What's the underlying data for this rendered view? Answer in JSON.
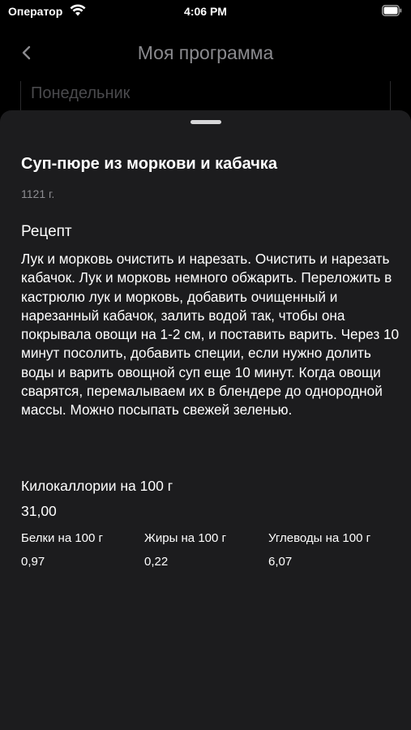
{
  "status_bar": {
    "carrier": "Оператор",
    "time": "4:06 PM"
  },
  "nav": {
    "title": "Моя программа",
    "back_icon": "chevron-left-icon"
  },
  "background": {
    "field_text": "Понедельник"
  },
  "sheet": {
    "title": "Суп-пюре из моркови и кабачка",
    "weight": "1121 г.",
    "recipe_heading": "Рецепт",
    "recipe_text": "Лук и морковь очистить и нарезать. Очистить и нарезать кабачок. Лук и морковь немного обжарить. Переложить в кастрюлю лук и морковь, добавить очищенный и нарезанный кабачок, залить водой так, чтобы она покрывала овощи на 1-2 см, и поставить варить. Через 10 минут посолить, добавить специи, если нужно долить воды и варить овощной суп еще 10 минут. Когда овощи сварятся, перемалываем их в блендере до однородной массы. Можно посыпать свежей зеленью.",
    "kcal_label": "Килокаллории на 100 г",
    "kcal_value": "31,00",
    "macros": [
      {
        "label": "Белки на 100 г",
        "value": "0,97"
      },
      {
        "label": "Жиры на 100 г",
        "value": "0,22"
      },
      {
        "label": "Углеводы на 100 г",
        "value": "6,07"
      }
    ]
  }
}
